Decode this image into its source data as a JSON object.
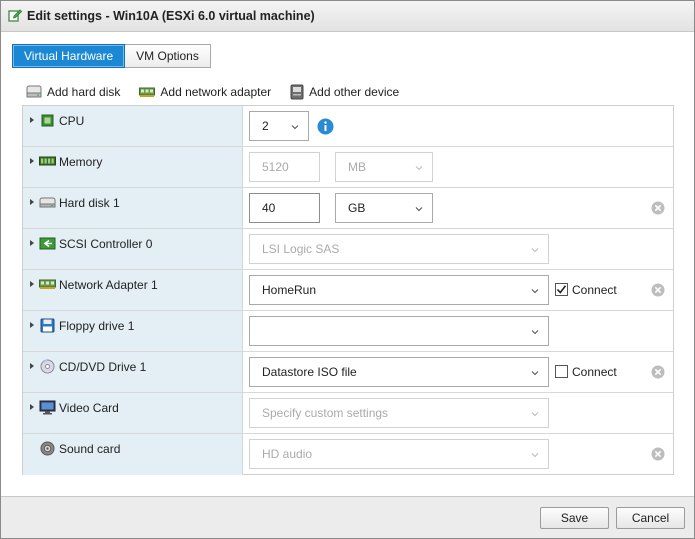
{
  "window": {
    "title": "Edit settings - Win10A (ESXi 6.0 virtual machine)"
  },
  "tabs": [
    {
      "label": "Virtual Hardware",
      "active": true
    },
    {
      "label": "VM Options",
      "active": false
    }
  ],
  "toolbar": {
    "add_hard_disk": "Add hard disk",
    "add_network_adapter": "Add network adapter",
    "add_other_device": "Add other device"
  },
  "devices": {
    "cpu": {
      "label": "CPU",
      "value": "2",
      "icon": "cpu-icon"
    },
    "memory": {
      "label": "Memory",
      "value": "5120",
      "unit": "MB",
      "icon": "memory-icon"
    },
    "hard_disk": {
      "label": "Hard disk 1",
      "value": "40",
      "unit": "GB",
      "icon": "hard-disk-icon"
    },
    "scsi": {
      "label": "SCSI Controller 0",
      "value": "LSI Logic SAS",
      "icon": "scsi-controller-icon"
    },
    "network": {
      "label": "Network Adapter 1",
      "value": "HomeRun",
      "connect_label": "Connect",
      "connected": true,
      "icon": "network-adapter-icon"
    },
    "floppy": {
      "label": "Floppy drive 1",
      "value": "",
      "icon": "floppy-icon"
    },
    "cddvd": {
      "label": "CD/DVD Drive 1",
      "value": "Datastore ISO file",
      "connect_label": "Connect",
      "connected": false,
      "icon": "cd-dvd-icon"
    },
    "video": {
      "label": "Video Card",
      "value": "Specify custom settings",
      "icon": "video-card-icon"
    },
    "sound": {
      "label": "Sound card",
      "value": "HD audio",
      "icon": "sound-card-icon"
    }
  },
  "footer": {
    "save_label": "Save",
    "cancel_label": "Cancel"
  },
  "colors": {
    "accent": "#1c88d4",
    "label_bg": "#e4eef5",
    "info": "#2a8ad3"
  }
}
